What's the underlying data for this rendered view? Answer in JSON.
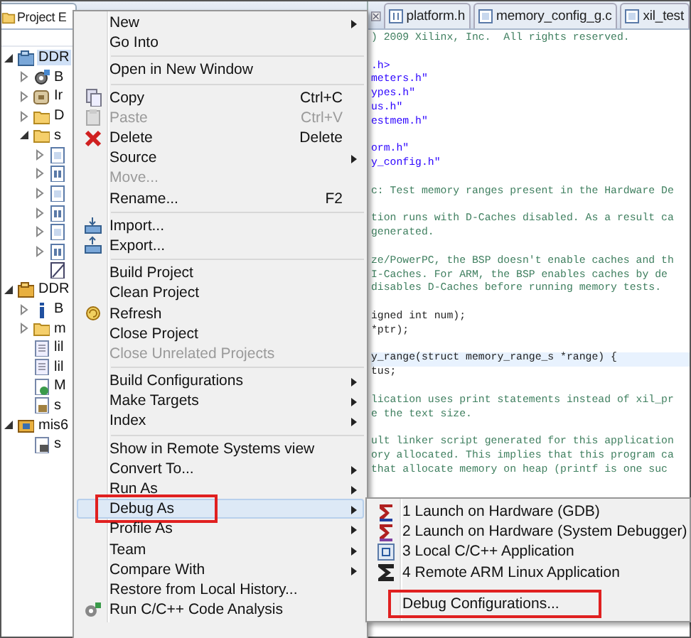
{
  "explorer": {
    "tab": "Project E",
    "tree": [
      {
        "label": "DDR",
        "kind": "project",
        "expanded": true,
        "selected": true,
        "children": [
          {
            "label": "B",
            "kind": "binaries",
            "expanded": false,
            "selected": false
          },
          {
            "label": "Ir",
            "kind": "includes",
            "expanded": false,
            "selected": false
          },
          {
            "label": "D",
            "kind": "folder",
            "expanded": false,
            "selected": false
          },
          {
            "label": "s",
            "kind": "folder",
            "expanded": true,
            "selected": false,
            "children": [
              {
                "kind": "cfile",
                "expanded": false,
                "selected": false
              },
              {
                "kind": "hfile",
                "expanded": false,
                "selected": false
              },
              {
                "kind": "cfile",
                "expanded": false,
                "selected": false
              },
              {
                "kind": "hfile",
                "expanded": false,
                "selected": false
              },
              {
                "kind": "cfile",
                "expanded": false,
                "selected": false
              },
              {
                "kind": "hfile",
                "expanded": false,
                "selected": false
              },
              {
                "kind": "script",
                "selected": false
              }
            ]
          }
        ]
      },
      {
        "label": "DDR",
        "kind": "bsp",
        "expanded": true,
        "selected": false,
        "children": [
          {
            "label": "B",
            "kind": "info",
            "expanded": false,
            "selected": false
          },
          {
            "label": "m",
            "kind": "folder",
            "expanded": false,
            "selected": false
          },
          {
            "label": "lil",
            "kind": "doc",
            "selected": false
          },
          {
            "label": "lil",
            "kind": "doc",
            "selected": false
          },
          {
            "label": "M",
            "kind": "make",
            "selected": false
          },
          {
            "label": "s",
            "kind": "config",
            "selected": false
          }
        ]
      },
      {
        "label": "mis6",
        "kind": "hw",
        "expanded": true,
        "selected": false,
        "children": [
          {
            "label": "s",
            "kind": "xml",
            "selected": false
          }
        ]
      }
    ]
  },
  "editor": {
    "tabs": [
      {
        "label": "platform.h",
        "kind": "h",
        "selected": false
      },
      {
        "label": "memory_config_g.c",
        "kind": "c",
        "selected": false
      },
      {
        "label": "xil_test",
        "kind": "c",
        "selected": false
      }
    ],
    "blocks": [
      {
        "lines": [
          {
            "text": ") 2009 Xilinx, Inc.  All rights reserved.",
            "kind": "comment",
            "current": false
          }
        ]
      },
      {
        "lines": [
          {
            "text": ".h>",
            "kind": "include",
            "current": false
          },
          {
            "text": "meters.h\"",
            "kind": "include",
            "current": false
          },
          {
            "text": "ypes.h\"",
            "kind": "include",
            "current": false
          },
          {
            "text": "us.h\"",
            "kind": "include",
            "current": false
          },
          {
            "text": "estmem.h\"",
            "kind": "include",
            "current": false
          }
        ]
      },
      {
        "lines": [
          {
            "text": "orm.h\"",
            "kind": "include",
            "current": false
          },
          {
            "text": "y_config.h\"",
            "kind": "include",
            "current": false
          }
        ]
      },
      {
        "lines": [
          {
            "text": "c: Test memory ranges present in the Hardware De",
            "kind": "comment",
            "current": false
          }
        ]
      },
      {
        "lines": [
          {
            "text": "tion runs with D-Caches disabled. As a result ca",
            "kind": "comment",
            "current": false
          },
          {
            "text": "generated.",
            "kind": "comment",
            "current": false
          }
        ]
      },
      {
        "lines": [
          {
            "text": "ze/PowerPC, the BSP doesn't enable caches and th",
            "kind": "comment",
            "current": false
          },
          {
            "text": "I-Caches. For ARM, the BSP enables caches by de",
            "kind": "comment",
            "current": false
          },
          {
            "text": "disables D-Caches before running memory tests.",
            "kind": "comment",
            "current": false
          }
        ]
      },
      {
        "lines": [
          {
            "text": "igned int num);",
            "kind": "code",
            "current": false
          },
          {
            "text": "*ptr);",
            "kind": "code",
            "current": false
          }
        ]
      },
      {
        "lines": [
          {
            "text": "y_range(struct memory_range_s *range) {",
            "kind": "code",
            "current": true
          },
          {
            "text": "tus;",
            "kind": "code",
            "current": false
          }
        ]
      },
      {
        "lines": [
          {
            "text": "lication uses print statements instead of xil_pr",
            "kind": "comment",
            "current": false
          },
          {
            "text": "e the text size.",
            "kind": "comment",
            "current": false
          }
        ]
      },
      {
        "lines": [
          {
            "text": "ult linker script generated for this application",
            "kind": "comment",
            "current": false
          },
          {
            "text": "ory allocated. This implies that this program ca",
            "kind": "comment",
            "current": false
          },
          {
            "text": "that allocate memory on heap (printf is one suc",
            "kind": "comment",
            "current": false
          }
        ]
      }
    ]
  },
  "context_menu": {
    "items": [
      {
        "kind": "item",
        "label": "New",
        "submenu": true,
        "disabled": false,
        "selected": false,
        "marked": false
      },
      {
        "kind": "item",
        "label": "Go Into",
        "submenu": false,
        "disabled": false,
        "selected": false,
        "marked": false
      },
      {
        "kind": "separator"
      },
      {
        "kind": "item",
        "label": "Open in New Window",
        "submenu": false,
        "disabled": false,
        "selected": false,
        "marked": false
      },
      {
        "kind": "separator"
      },
      {
        "kind": "item",
        "label": "Copy",
        "shortcut": "Ctrl+C",
        "submenu": false,
        "disabled": false,
        "selected": false,
        "marked": false
      },
      {
        "kind": "item",
        "label": "Paste",
        "shortcut": "Ctrl+V",
        "submenu": false,
        "disabled": true,
        "selected": false,
        "marked": false
      },
      {
        "kind": "item",
        "label": "Delete",
        "shortcut": "Delete",
        "submenu": false,
        "disabled": false,
        "selected": false,
        "marked": false
      },
      {
        "kind": "item",
        "label": "Source",
        "submenu": true,
        "disabled": false,
        "selected": false,
        "marked": false
      },
      {
        "kind": "item",
        "label": "Move...",
        "submenu": false,
        "disabled": true,
        "selected": false,
        "marked": false
      },
      {
        "kind": "item",
        "label": "Rename...",
        "shortcut": "F2",
        "submenu": false,
        "disabled": false,
        "selected": false,
        "marked": false
      },
      {
        "kind": "separator"
      },
      {
        "kind": "item",
        "label": "Import...",
        "submenu": false,
        "disabled": false,
        "selected": false,
        "marked": false
      },
      {
        "kind": "item",
        "label": "Export...",
        "submenu": false,
        "disabled": false,
        "selected": false,
        "marked": false
      },
      {
        "kind": "separator"
      },
      {
        "kind": "item",
        "label": "Build Project",
        "submenu": false,
        "disabled": false,
        "selected": false,
        "marked": false
      },
      {
        "kind": "item",
        "label": "Clean Project",
        "submenu": false,
        "disabled": false,
        "selected": false,
        "marked": false
      },
      {
        "kind": "item",
        "label": "Refresh",
        "submenu": false,
        "disabled": false,
        "selected": false,
        "marked": false
      },
      {
        "kind": "item",
        "label": "Close Project",
        "submenu": false,
        "disabled": false,
        "selected": false,
        "marked": false
      },
      {
        "kind": "item",
        "label": "Close Unrelated Projects",
        "submenu": false,
        "disabled": true,
        "selected": false,
        "marked": false
      },
      {
        "kind": "separator"
      },
      {
        "kind": "item",
        "label": "Build Configurations",
        "submenu": true,
        "disabled": false,
        "selected": false,
        "marked": false
      },
      {
        "kind": "item",
        "label": "Make Targets",
        "submenu": true,
        "disabled": false,
        "selected": false,
        "marked": false
      },
      {
        "kind": "item",
        "label": "Index",
        "submenu": true,
        "disabled": false,
        "selected": false,
        "marked": false
      },
      {
        "kind": "separator"
      },
      {
        "kind": "item",
        "label": "Show in Remote Systems view",
        "submenu": false,
        "disabled": false,
        "selected": false,
        "marked": false
      },
      {
        "kind": "item",
        "label": "Convert To...",
        "submenu": true,
        "disabled": false,
        "selected": false,
        "marked": false
      },
      {
        "kind": "item",
        "label": "Run As",
        "submenu": true,
        "disabled": false,
        "selected": false,
        "marked": false
      },
      {
        "kind": "item",
        "label": "Debug As",
        "submenu": true,
        "disabled": false,
        "selected": true,
        "marked": true
      },
      {
        "kind": "item",
        "label": "Profile As",
        "submenu": true,
        "disabled": false,
        "selected": false,
        "marked": false
      },
      {
        "kind": "item",
        "label": "Team",
        "submenu": true,
        "disabled": false,
        "selected": false,
        "marked": false
      },
      {
        "kind": "item",
        "label": "Compare With",
        "submenu": true,
        "disabled": false,
        "selected": false,
        "marked": false
      },
      {
        "kind": "item",
        "label": "Restore from Local History...",
        "submenu": false,
        "disabled": false,
        "selected": false,
        "marked": false
      },
      {
        "kind": "item",
        "label": "Run C/C++ Code Analysis",
        "submenu": false,
        "disabled": false,
        "selected": false,
        "marked": false
      }
    ]
  },
  "debug_submenu": {
    "items": [
      {
        "kind": "item",
        "label": "1 Launch on Hardware (GDB)",
        "marked": false
      },
      {
        "kind": "item",
        "label": "2 Launch on Hardware (System Debugger)",
        "marked": false
      },
      {
        "kind": "item",
        "label": "3 Local C/C++ Application",
        "marked": false
      },
      {
        "kind": "item",
        "label": "4 Remote ARM Linux Application",
        "marked": false
      },
      {
        "kind": "separator"
      },
      {
        "kind": "item",
        "label": "Debug Configurations...",
        "marked": true
      }
    ]
  }
}
